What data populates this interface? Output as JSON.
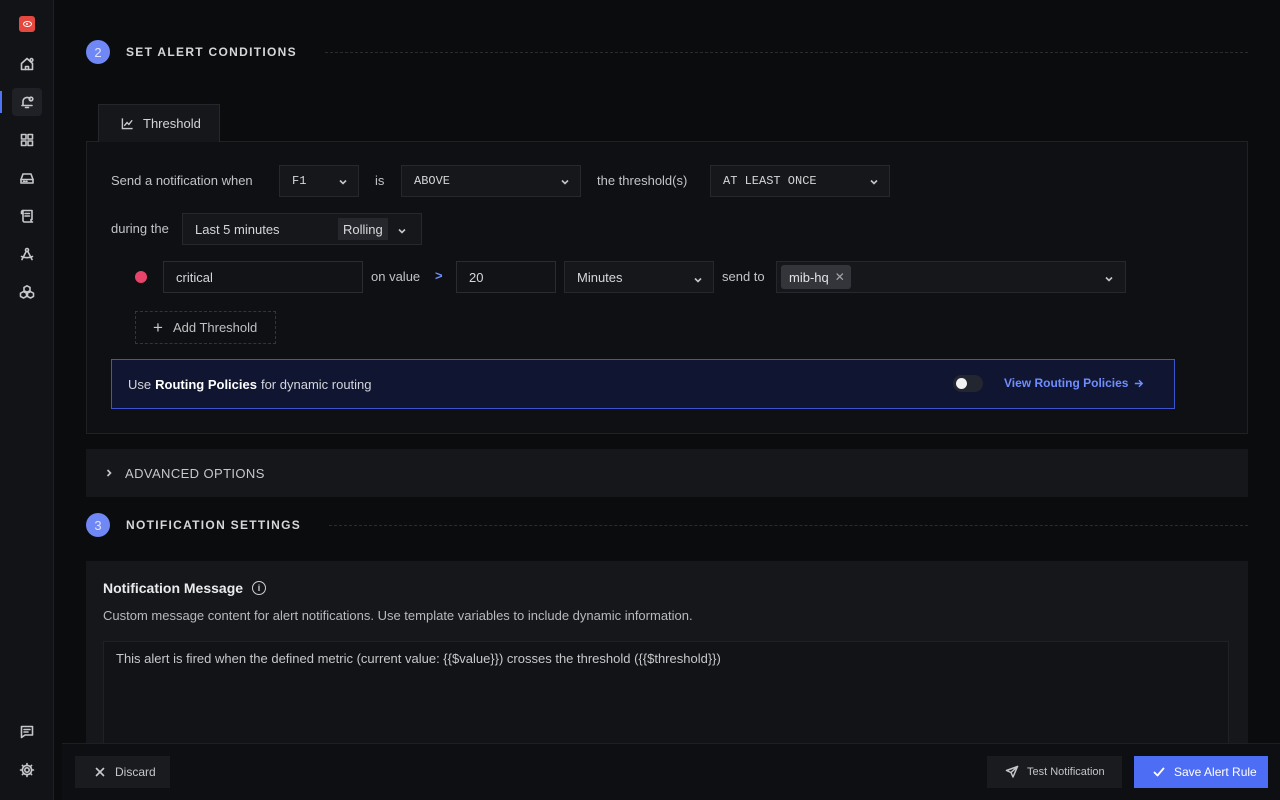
{
  "sidebar": {
    "items": [
      {
        "name": "home-icon"
      },
      {
        "name": "alerts-icon",
        "active": true
      },
      {
        "name": "dashboards-icon"
      },
      {
        "name": "infrastructure-icon"
      },
      {
        "name": "logs-icon"
      },
      {
        "name": "traces-icon"
      },
      {
        "name": "integrations-icon"
      },
      {
        "name": "feedback-icon"
      },
      {
        "name": "settings-icon"
      }
    ],
    "logo": "signoz-logo"
  },
  "alert_conditions": {
    "step_number": "2",
    "title": "SET ALERT CONDITIONS",
    "tab_label": "Threshold",
    "send_when_label": "Send a notification when",
    "query_value": "F1",
    "is_label": "is",
    "operator_value": "ABOVE",
    "thresholds_label": "the threshold(s)",
    "match_type_value": "AT LEAST ONCE",
    "during_label": "during the",
    "window_value": "Last 5 minutes",
    "window_type_value": "Rolling",
    "threshold": {
      "name_value": "critical",
      "color": "#e8436a",
      "on_value_label": "on value",
      "operator_symbol": ">",
      "value": "20",
      "unit_value": "Minutes",
      "send_to_label": "send to",
      "channel_tag": "mib-hq"
    },
    "add_threshold_label": "Add Threshold",
    "routing": {
      "prefix": "Use",
      "bold": "Routing Policies",
      "suffix": "for dynamic routing",
      "toggle_on": false,
      "view_link": "View Routing Policies"
    }
  },
  "advanced_options_label": "ADVANCED OPTIONS",
  "notification_settings": {
    "step_number": "3",
    "title": "NOTIFICATION SETTINGS",
    "message_title": "Notification Message",
    "message_description": "Custom message content for alert notifications. Use template variables to include dynamic information.",
    "message_value": "This alert is fired when the defined metric (current value: {{$value}}) crosses the threshold ({{$threshold}})"
  },
  "footer": {
    "discard_label": "Discard",
    "test_label": "Test Notification",
    "save_label": "Save Alert Rule"
  },
  "colors": {
    "accent": "#4e6df5",
    "step_badge": "#6f88f5",
    "link": "#6f8dff",
    "routing_border": "#3c55cf",
    "logo": "#e5483f"
  }
}
